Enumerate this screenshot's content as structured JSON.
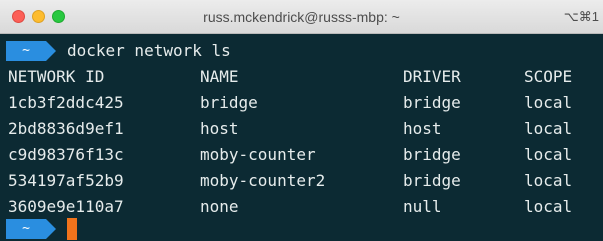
{
  "window": {
    "title": "russ.mckendrick@russs-mbp: ~",
    "shortcut": "⌥⌘1"
  },
  "prompt": {
    "symbol": "~",
    "command": "docker network ls"
  },
  "table": {
    "columns": [
      "NETWORK ID",
      "NAME",
      "DRIVER",
      "SCOPE"
    ],
    "rows": [
      [
        "1cb3f2ddc425",
        "bridge",
        "bridge",
        "local"
      ],
      [
        "2bd8836d9ef1",
        "host",
        "host",
        "local"
      ],
      [
        "c9d98376f13c",
        "moby-counter",
        "bridge",
        "local"
      ],
      [
        "534197af52b9",
        "moby-counter2",
        "bridge",
        "local"
      ],
      [
        "3609e9e110a7",
        "none",
        "null",
        "local"
      ]
    ]
  },
  "prompt2": {
    "symbol": "~"
  },
  "colors": {
    "background": "#0c2a33",
    "prompt_badge": "#2a8ee0",
    "cursor": "#f0731c",
    "text": "#e6ecec"
  }
}
